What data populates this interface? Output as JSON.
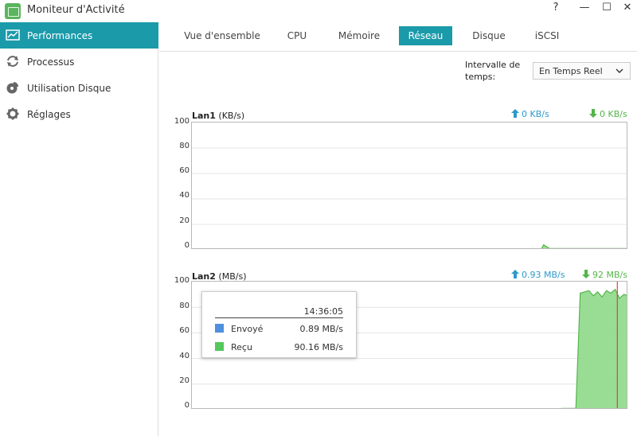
{
  "window": {
    "title": "Moniteur d'Activité",
    "controls": [
      "?",
      "—",
      "☐",
      "✕"
    ]
  },
  "sidebar": {
    "items": [
      {
        "label": "Performances",
        "icon": "performance-chart-icon",
        "active": true
      },
      {
        "label": "Processus",
        "icon": "refresh-arrows-icon",
        "active": false
      },
      {
        "label": "Utilisation Disque",
        "icon": "disk-pie-icon",
        "active": false
      },
      {
        "label": "Réglages",
        "icon": "gear-icon",
        "active": false
      }
    ]
  },
  "tabs": [
    {
      "label": "Vue d'ensemble",
      "active": false
    },
    {
      "label": "CPU",
      "active": false
    },
    {
      "label": "Mémoire",
      "active": false
    },
    {
      "label": "Réseau",
      "active": true
    },
    {
      "label": "Disque",
      "active": false
    },
    {
      "label": "iSCSI",
      "active": false
    }
  ],
  "interval": {
    "label": "Intervalle de temps:",
    "selected": "En Temps Reel"
  },
  "colors": {
    "accent": "#1b9aaa",
    "upload": "#2b9ac9",
    "download": "#53b548",
    "sent_swatch": "#4f8fe0",
    "received_swatch": "#56c75c",
    "marker": "#e0443c"
  },
  "chart_data": [
    {
      "type": "area",
      "title": "Lan1",
      "unit": "(KB/s)",
      "ylim": [
        0,
        100
      ],
      "yticks": [
        "100",
        "80",
        "60",
        "40",
        "20",
        "0"
      ],
      "grid": true,
      "upload_rate": "0 KB/s",
      "download_rate": "0 KB/s",
      "x": [
        0,
        5,
        10,
        15,
        20,
        25,
        30,
        35,
        40,
        45,
        50,
        55,
        60,
        65,
        70,
        75,
        80,
        80.6,
        81,
        82,
        85,
        90,
        95,
        100
      ],
      "series": [
        {
          "values": [
            0,
            0,
            0,
            0,
            0,
            0,
            0,
            0,
            0,
            0,
            0,
            0,
            0,
            0,
            0,
            0,
            0,
            4,
            3,
            1,
            1,
            1,
            1,
            1
          ]
        }
      ]
    },
    {
      "type": "area",
      "title": "Lan2",
      "unit": "(MB/s)",
      "ylim": [
        0,
        100
      ],
      "yticks": [
        "100",
        "80",
        "60",
        "40",
        "20",
        "0"
      ],
      "grid": true,
      "upload_rate": "0.93 MB/s",
      "download_rate": "92 MB/s",
      "x": [
        0,
        10,
        20,
        30,
        40,
        50,
        60,
        70,
        80,
        85,
        88,
        89,
        91,
        92,
        93,
        94,
        95,
        96,
        97,
        98,
        99,
        100
      ],
      "series": [
        {
          "values": [
            0,
            0,
            0,
            0,
            0,
            0,
            0,
            0,
            0,
            1,
            1,
            91,
            93,
            89,
            92,
            88,
            93,
            91,
            94,
            87,
            90,
            89
          ]
        }
      ],
      "cursor_x": 97.5
    }
  ],
  "tooltip": {
    "time": "14:36:05",
    "rows": [
      {
        "name": "Envoyé",
        "value": "0.89 MB/s"
      },
      {
        "name": "Reçu",
        "value": "90.16 MB/s"
      }
    ]
  }
}
